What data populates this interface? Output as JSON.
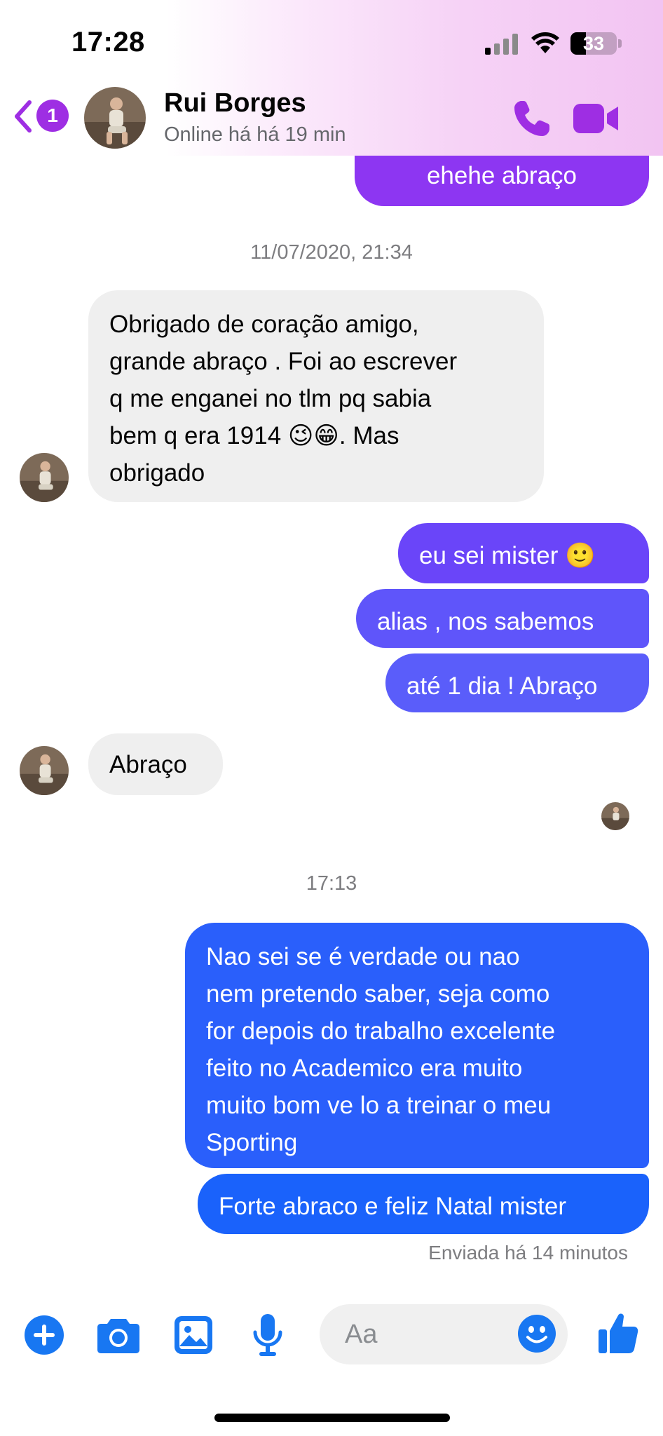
{
  "status_bar": {
    "time": "17:28",
    "battery": "33"
  },
  "header": {
    "back_badge": "1",
    "contact_name": "Rui Borges",
    "contact_status": "Online há há 19 min"
  },
  "messages": {
    "m0": "ehehe abraço",
    "ts1": "11/07/2020, 21:34",
    "m1": [
      "Obrigado de coração amigo,",
      "grande abraço . Foi ao escrever",
      "q me enganei no tlm pq sabia",
      "bem q era 1914 😉😁. Mas",
      "obrigado"
    ],
    "m2": "eu sei mister 🙂",
    "m3": "alias , nos sabemos",
    "m4": "até 1 dia ! Abraço",
    "m5": "Abraço",
    "ts2": "17:13",
    "m6": [
      "Nao sei se é verdade ou nao",
      "nem pretendo saber, seja como",
      "for depois do trabalho excelente",
      "feito no Academico era muito",
      "muito bom ve lo a treinar o meu",
      "Sporting"
    ],
    "m7": "Forte abraco e feliz Natal mister",
    "sent_status": "Enviada há 14 minutos"
  },
  "composer": {
    "placeholder": "Aa"
  },
  "colors": {
    "accent_purple": "#9e2ee3",
    "bubble_purple": "#8d36f2",
    "bubble_violet": "#6a4bf8",
    "bubble_blue": "#1d63fb",
    "composer_blue": "#1877f2",
    "incoming_bubble": "#efefef"
  },
  "icons": [
    "back-chevron-icon",
    "phone-icon",
    "video-camera-icon",
    "plus-icon",
    "camera-icon",
    "image-icon",
    "microphone-icon",
    "emoji-icon",
    "thumbs-up-icon"
  ]
}
